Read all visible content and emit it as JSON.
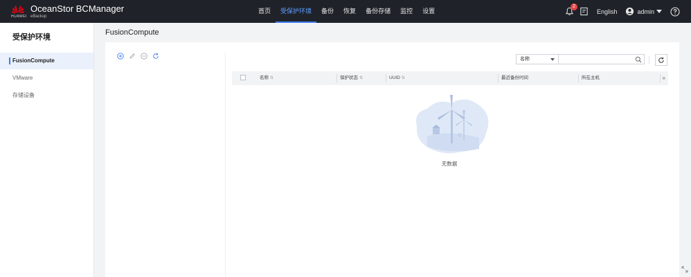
{
  "header": {
    "logo_text": "HUAWEI",
    "brand_title": "OceanStor BCManager",
    "brand_sub": "eBackup",
    "nav": [
      {
        "label": "首页"
      },
      {
        "label": "受保护环境"
      },
      {
        "label": "备份"
      },
      {
        "label": "恢复"
      },
      {
        "label": "备份存储"
      },
      {
        "label": "监控"
      },
      {
        "label": "设置"
      }
    ],
    "active_nav_index": 1,
    "notification_count": "2",
    "language": "English",
    "username": "admin"
  },
  "sidebar": {
    "title": "受保护环境",
    "items": [
      {
        "label": "FusionCompute"
      },
      {
        "label": "VMware"
      },
      {
        "label": "存储设备"
      }
    ],
    "active_index": 0
  },
  "main": {
    "page_title": "FusionCompute",
    "search": {
      "field_selected": "名称",
      "placeholder": ""
    },
    "table": {
      "columns": [
        {
          "label": "名称"
        },
        {
          "label": "保护状态"
        },
        {
          "label": "UUID"
        },
        {
          "label": "最近备份时间"
        },
        {
          "label": "所在主机"
        }
      ]
    },
    "empty_text": "无数据"
  },
  "icons": {
    "tree_tools": [
      "add-circle-icon",
      "edit-pencil-icon",
      "remove-circle-icon",
      "refresh-icon"
    ]
  },
  "colors": {
    "topbar": "#1f2329",
    "accent": "#3d7cf0",
    "badge": "#e54545"
  }
}
